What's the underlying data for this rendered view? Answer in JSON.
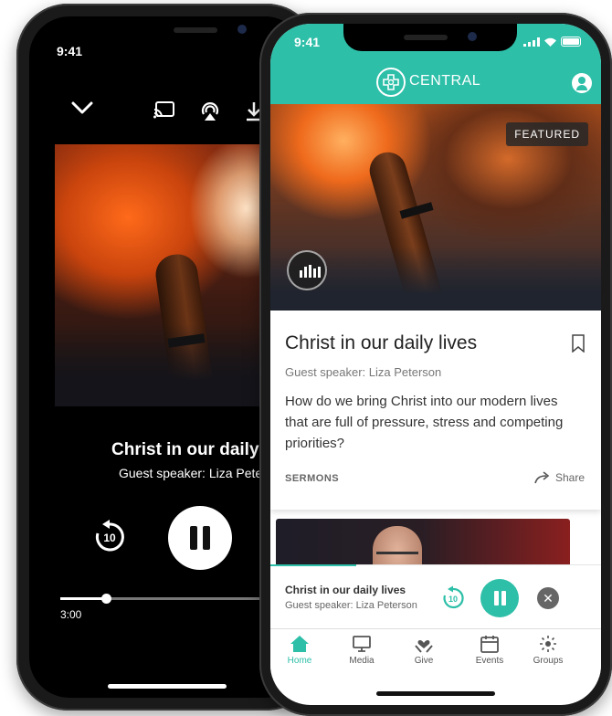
{
  "back_phone": {
    "status_time": "9:41",
    "icons": [
      "chevron-down-icon",
      "cast-icon",
      "airplay-icon",
      "download-icon"
    ],
    "now_playing": {
      "title": "Christ in our daily liv",
      "speaker": "Guest speaker: Liza Petersc",
      "skip_back_seconds": "10",
      "elapsed": "3:00",
      "progress_fraction": 0.2
    }
  },
  "front_phone": {
    "status_time": "9:41",
    "app_name": "CENTRAL",
    "colors": {
      "accent": "#2dbfa8",
      "text": "#222222",
      "muted": "#777777"
    },
    "featured": {
      "badge": "FEATURED",
      "title": "Christ in our daily lives",
      "speaker": "Guest speaker: Liza Peterson",
      "description": "How do we bring Christ into our modern lives that are full of pressure, stress and competing priorities?",
      "category": "SERMONS",
      "share_label": "Share"
    },
    "mini_player": {
      "title": "Christ in our daily lives",
      "speaker": "Guest speaker: Liza Peterson",
      "skip_back_seconds": "10",
      "progress_fraction": 0.26
    },
    "tabs": [
      {
        "label": "Home",
        "icon": "home-icon",
        "active": true
      },
      {
        "label": "Media",
        "icon": "monitor-icon",
        "active": false
      },
      {
        "label": "Give",
        "icon": "heart-hands-icon",
        "active": false
      },
      {
        "label": "Events",
        "icon": "calendar-icon",
        "active": false
      },
      {
        "label": "Groups",
        "icon": "groups-icon",
        "active": false
      }
    ]
  }
}
